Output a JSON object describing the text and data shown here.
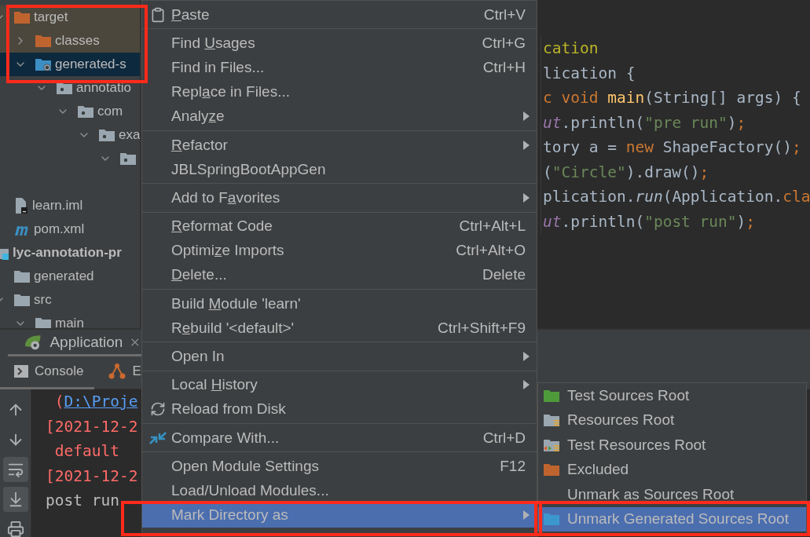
{
  "tree": [
    {
      "children": [
        {
          "label": "target",
          "kind": "excluded",
          "highlighted": true,
          "selected": false,
          "expanded": true,
          "children": [
            {
              "label": "classes",
              "kind": "excluded",
              "highlighted": true,
              "selected": false,
              "expanded": false
            },
            {
              "label": "generated-s",
              "kind": "generated",
              "highlighted": false,
              "selected": true,
              "expanded": true,
              "children": [
                {
                  "label": "annotatio",
                  "kind": "package",
                  "highlighted": false,
                  "selected": false,
                  "expanded": true,
                  "children": [
                    {
                      "label": "com",
                      "kind": "package",
                      "highlighted": false,
                      "selected": false,
                      "expanded": true,
                      "children": [
                        {
                          "label": "exa",
                          "kind": "package",
                          "highlighted": false,
                          "selected": false,
                          "expanded": true,
                          "children": [
                            {
                              "kind": "package",
                              "highlighted": false,
                              "selected": false,
                              "expanded": true
                            }
                          ]
                        }
                      ]
                    }
                  ]
                }
              ]
            }
          ]
        },
        {
          "label": "learn.iml",
          "kind": "iml",
          "highlighted": false,
          "selected": false
        },
        {
          "label": "pom.xml",
          "kind": "maven",
          "highlighted": false,
          "selected": false
        }
      ]
    },
    {
      "label": "lyc-annotation-pr",
      "kind": "module",
      "highlighted": false,
      "selected": false,
      "expanded": true,
      "children": [
        {
          "label": "generated",
          "kind": "folder",
          "highlighted": false,
          "selected": false
        },
        {
          "label": "src",
          "kind": "folder",
          "highlighted": false,
          "selected": false,
          "expanded": true,
          "children": [
            {
              "label": "main",
              "kind": "folder",
              "highlighted": false,
              "selected": false,
              "expanded": true
            }
          ]
        }
      ]
    }
  ],
  "code_lines": [
    [
      {
        "text": "cation",
        "kind": "annotation"
      }
    ],
    [
      {
        "text": "lication {",
        "kind": "plain"
      }
    ],
    [
      {
        "text": "c void ",
        "kind": "keyword"
      },
      {
        "text": "main",
        "kind": "method"
      },
      {
        "text": "(String[] args) {",
        "kind": "plain"
      }
    ],
    [
      {
        "text": "ut",
        "kind": "static"
      },
      {
        "text": ".println(",
        "kind": "plain"
      },
      {
        "text": "\"pre run\"",
        "kind": "string"
      },
      {
        "text": ")",
        "kind": "plain"
      },
      {
        "text": ";",
        "kind": "keyword"
      }
    ],
    [
      {
        "text": "tory a = ",
        "kind": "plain"
      },
      {
        "text": "new",
        "kind": "keyword"
      },
      {
        "text": " ShapeFactory()",
        "kind": "plain"
      },
      {
        "text": ";",
        "kind": "keyword"
      }
    ],
    [
      {
        "text": "(",
        "kind": "plain"
      },
      {
        "text": "\"Circle\"",
        "kind": "string"
      },
      {
        "text": ").draw()",
        "kind": "plain"
      },
      {
        "text": ";",
        "kind": "keyword"
      }
    ],
    [
      {
        "text": "plication.",
        "kind": "plain"
      },
      {
        "text": "run",
        "kind": "italic"
      },
      {
        "text": "(Application.",
        "kind": "plain"
      },
      {
        "text": "cla",
        "kind": "keyword"
      }
    ],
    [
      {
        "text": "ut",
        "kind": "static"
      },
      {
        "text": ".println(",
        "kind": "plain"
      },
      {
        "text": "\"post run\"",
        "kind": "string"
      },
      {
        "text": ")",
        "kind": "plain"
      },
      {
        "text": ";",
        "kind": "keyword"
      }
    ]
  ],
  "run_window": {
    "tabs": [
      {
        "label": "Application",
        "selected": true
      }
    ],
    "subtabs": [
      {
        "label": "Console",
        "kind": "console",
        "selected": true
      },
      {
        "label": "E",
        "kind": "endpoints",
        "selected": false
      }
    ],
    "toolbar": [
      {
        "kind": "up",
        "on": false
      },
      {
        "kind": "down",
        "on": false
      },
      {
        "kind": "wrap",
        "on": true
      },
      {
        "kind": "scroll-end",
        "on": true
      },
      {
        "kind": "print",
        "on": false
      }
    ],
    "console_lines": [
      [
        {
          "text": " (",
          "kind": "error"
        },
        {
          "text": "D:\\Proje",
          "kind": "link"
        }
      ],
      [
        {
          "text": "[2021-12-2",
          "kind": "error"
        }
      ],
      [
        {
          "text": " default",
          "kind": "error"
        }
      ],
      [
        {
          "text": "[2021-12-2",
          "kind": "error"
        }
      ],
      [
        {
          "text": "post run",
          "kind": "normal"
        }
      ]
    ]
  },
  "context_menu": [
    {
      "kind": "paste",
      "label": [
        {
          "text": "P",
          "underline": true
        },
        {
          "text": "aste",
          "underline": false
        }
      ],
      "shortcut": "Ctrl+V",
      "submenu": false,
      "selected": false
    },
    {
      "kind": "separator"
    },
    {
      "kind": "item",
      "label": [
        {
          "text": "Find ",
          "underline": false
        },
        {
          "text": "U",
          "underline": true
        },
        {
          "text": "sages",
          "underline": false
        }
      ],
      "shortcut": "Ctrl+G",
      "submenu": false,
      "selected": false
    },
    {
      "kind": "item",
      "label": [
        {
          "text": "Find in Files...",
          "underline": false
        }
      ],
      "shortcut": "Ctrl+H",
      "submenu": false,
      "selected": false
    },
    {
      "kind": "item",
      "label": [
        {
          "text": "Repl",
          "underline": false
        },
        {
          "text": "a",
          "underline": true
        },
        {
          "text": "ce in Files...",
          "underline": false
        }
      ],
      "submenu": false,
      "selected": false
    },
    {
      "kind": "item",
      "label": [
        {
          "text": "Analy",
          "underline": false
        },
        {
          "text": "z",
          "underline": true
        },
        {
          "text": "e",
          "underline": false
        }
      ],
      "submenu": true,
      "selected": false
    },
    {
      "kind": "separator"
    },
    {
      "kind": "item",
      "label": [
        {
          "text": "R",
          "underline": true
        },
        {
          "text": "efactor",
          "underline": false
        }
      ],
      "submenu": true,
      "selected": false
    },
    {
      "kind": "item",
      "label": [
        {
          "text": "JBLSpringBootAppGen",
          "underline": false
        }
      ],
      "submenu": false,
      "selected": false
    },
    {
      "kind": "separator"
    },
    {
      "kind": "item",
      "label": [
        {
          "text": "Add to F",
          "underline": false
        },
        {
          "text": "a",
          "underline": true
        },
        {
          "text": "vorites",
          "underline": false
        }
      ],
      "submenu": true,
      "selected": false
    },
    {
      "kind": "separator"
    },
    {
      "kind": "item",
      "label": [
        {
          "text": "R",
          "underline": true
        },
        {
          "text": "eformat Code",
          "underline": false
        }
      ],
      "shortcut": "Ctrl+Alt+L",
      "submenu": false,
      "selected": false
    },
    {
      "kind": "item",
      "label": [
        {
          "text": "Optimi",
          "underline": false
        },
        {
          "text": "z",
          "underline": true
        },
        {
          "text": "e Imports",
          "underline": false
        }
      ],
      "shortcut": "Ctrl+Alt+O",
      "submenu": false,
      "selected": false
    },
    {
      "kind": "item",
      "label": [
        {
          "text": "D",
          "underline": true
        },
        {
          "text": "elete...",
          "underline": false
        }
      ],
      "shortcut": "Delete",
      "submenu": false,
      "selected": false
    },
    {
      "kind": "separator"
    },
    {
      "kind": "item",
      "label": [
        {
          "text": "Build ",
          "underline": false
        },
        {
          "text": "M",
          "underline": true
        },
        {
          "text": "odule 'learn'",
          "underline": false
        }
      ],
      "submenu": false,
      "selected": false
    },
    {
      "kind": "item",
      "label": [
        {
          "text": "R",
          "underline": false
        },
        {
          "text": "e",
          "underline": true
        },
        {
          "text": "build '<default>'",
          "underline": false
        }
      ],
      "shortcut": "Ctrl+Shift+F9",
      "submenu": false,
      "selected": false
    },
    {
      "kind": "separator"
    },
    {
      "kind": "item",
      "label": [
        {
          "text": "Open In",
          "underline": false
        }
      ],
      "submenu": true,
      "selected": false
    },
    {
      "kind": "separator"
    },
    {
      "kind": "item",
      "label": [
        {
          "text": "Local ",
          "underline": false
        },
        {
          "text": "H",
          "underline": true
        },
        {
          "text": "istory",
          "underline": false
        }
      ],
      "submenu": true,
      "selected": false
    },
    {
      "kind": "reload",
      "label": [
        {
          "text": "Reload from Disk",
          "underline": false
        }
      ],
      "submenu": false,
      "selected": false
    },
    {
      "kind": "separator"
    },
    {
      "kind": "compare",
      "label": [
        {
          "text": "Compare With...",
          "underline": false
        }
      ],
      "shortcut": "Ctrl+D",
      "submenu": false,
      "selected": false
    },
    {
      "kind": "separator"
    },
    {
      "kind": "item",
      "label": [
        {
          "text": "Open Module Settings",
          "underline": false
        }
      ],
      "shortcut": "F12",
      "submenu": false,
      "selected": false
    },
    {
      "kind": "item",
      "label": [
        {
          "text": "Load/Unload Modules...",
          "underline": false
        }
      ],
      "submenu": false,
      "selected": false
    },
    {
      "kind": "item",
      "label": [
        {
          "text": "Mark Directory as",
          "underline": false
        }
      ],
      "submenu": true,
      "selected": true
    }
  ],
  "submenu": [
    {
      "label": "Test Sources Root",
      "kind": "tests",
      "selected": false
    },
    {
      "label": "Resources Root",
      "kind": "resources",
      "selected": false
    },
    {
      "label": "Test Resources Root",
      "kind": "testresources",
      "selected": false
    },
    {
      "label": "Excluded",
      "kind": "excluded",
      "selected": false
    },
    {
      "label": "Unmark as Sources Root",
      "kind": "plain",
      "selected": false
    },
    {
      "label": "Unmark Generated Sources Root",
      "kind": "generated",
      "selected": true
    }
  ]
}
